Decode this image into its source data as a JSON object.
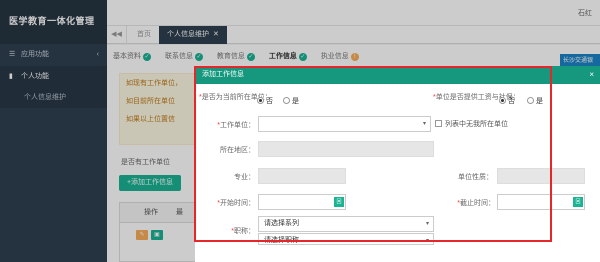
{
  "app": {
    "logo_text": "医学教育一体化管理",
    "user_label": "石红"
  },
  "sidebar": {
    "items": [
      {
        "label": "应用功能",
        "icon": "grid-icon"
      },
      {
        "label": "个人功能",
        "icon": "user-icon"
      }
    ],
    "subitems": [
      {
        "label": "个人信息维护"
      }
    ]
  },
  "tabs": {
    "nav_left": "◀◀",
    "home": "首页",
    "current": "个人信息维护",
    "close": "✕"
  },
  "steps": [
    {
      "label": "基本资料",
      "status": "ok"
    },
    {
      "label": "联系信息",
      "status": "ok"
    },
    {
      "label": "教育信息",
      "status": "ok"
    },
    {
      "label": "工作信息",
      "status": "ok"
    },
    {
      "label": "执业信息",
      "status": "warn"
    }
  ],
  "right_button": "长沙交通银",
  "alerts": [
    "如现有工作单位，",
    "如目前所在单位",
    "如果以上位置信"
  ],
  "section": {
    "title": "是否有工作单位",
    "add_button": "+添加工作信息"
  },
  "mini_table": {
    "header": "操作",
    "header2": "最"
  },
  "modal": {
    "title": "添加工作信息",
    "close": "×",
    "fields": {
      "is_current_label": "是否为当前所在单位：",
      "is_current_no": "否",
      "is_current_yes": "是",
      "pays_label": "单位是否提供工资与社保：",
      "pays_no": "否",
      "pays_yes": "是",
      "unit_label": "工作单位：",
      "unit_value": "",
      "no_unit_check": "列表中无我所在单位",
      "region_label": "所在地区：",
      "dept_label": "专业：",
      "nature_label": "单位性质：",
      "start_label": "开始时间：",
      "end_label": "截止时间：",
      "title_label": "职称：",
      "title_select": "请选择系列",
      "title_select2": "请选择职称",
      "cal_icon_text": "回"
    }
  },
  "colors": {
    "sidebar": "#2f4050",
    "accent": "#1ab394",
    "modal_header": "#16987e",
    "highlight": "#e5262b"
  }
}
